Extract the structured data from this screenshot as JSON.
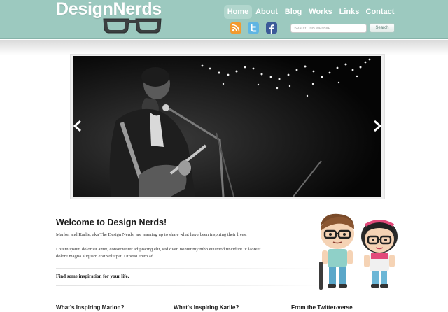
{
  "header": {
    "logo_text": "DesignNerds",
    "logo_icon": "glasses-icon",
    "brand_color": "#9cc9bf"
  },
  "nav": {
    "items": [
      {
        "label": "Home",
        "active": true
      },
      {
        "label": "About",
        "active": false
      },
      {
        "label": "Blog",
        "active": false
      },
      {
        "label": "Works",
        "active": false
      },
      {
        "label": "Links",
        "active": false
      },
      {
        "label": "Contact",
        "active": false
      }
    ]
  },
  "social": [
    {
      "icon": "rss-icon"
    },
    {
      "icon": "twitter-icon"
    },
    {
      "icon": "facebook-icon"
    }
  ],
  "search": {
    "placeholder": "Search this website ...",
    "button_label": "Search"
  },
  "slider": {
    "prev_icon": "arrow-left-icon",
    "next_icon": "arrow-right-icon"
  },
  "welcome": {
    "title": "Welcome to Design Nerds!",
    "intro": "Marlon and Karlie, aka The Design Nerds, are teaming up to share what have been inspiring their lives.",
    "lorem_line1": "Lorem ipsum dolor sit amet, consectetuer adipiscing elit, sed diam nonummy nibh euismod tincidunt ut laoreet",
    "lorem_line2": "dolore magna aliquam erat volutpat. Ut wisi enim ad.",
    "link_text": "Find some inspiration for your life."
  },
  "columns": [
    {
      "title": "What's Inspiring Marlon?"
    },
    {
      "title": "What's Inspiring Karlie?"
    },
    {
      "title": "From the Twitter-verse"
    }
  ]
}
